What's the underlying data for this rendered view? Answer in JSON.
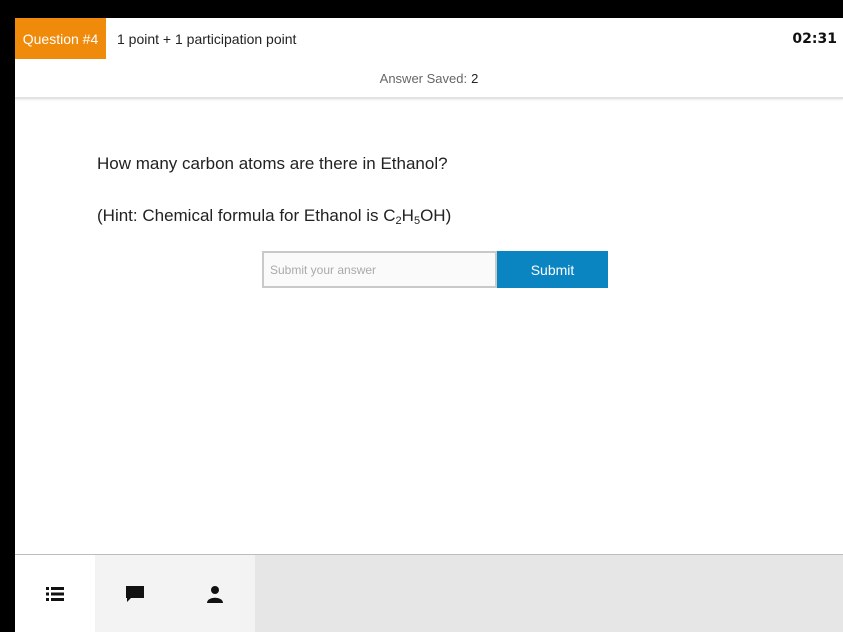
{
  "header": {
    "question_label": "Question #4",
    "points_text": "1 point + 1 participation point",
    "timer": "02:31",
    "saved_label": "Answer Saved:",
    "saved_count": "2"
  },
  "question": {
    "text": "How many carbon atoms are there in Ethanol?",
    "hint_prefix": "(Hint: Chemical formula for Ethanol is C",
    "hint_sub1": "2",
    "hint_mid": "H",
    "hint_sub2": "5",
    "hint_suffix": "OH)"
  },
  "answer": {
    "placeholder": "Submit your answer",
    "value": "",
    "submit_label": "Submit"
  },
  "colors": {
    "badge": "#f08a0a",
    "submit": "#0a85c2"
  },
  "nav": {
    "tabs": [
      {
        "icon": "list-icon"
      },
      {
        "icon": "chat-icon"
      },
      {
        "icon": "user-icon"
      }
    ]
  }
}
